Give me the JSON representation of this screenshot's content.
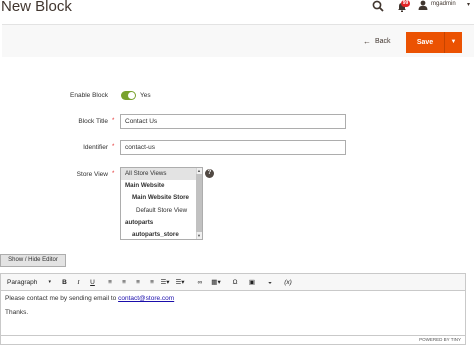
{
  "header": {
    "title": "New Block",
    "notifications_count": "99",
    "username": "mgadmin"
  },
  "actions": {
    "back_label": "Back",
    "save_label": "Save"
  },
  "form": {
    "enable_block": {
      "label": "Enable Block",
      "value_text": "Yes",
      "enabled": true
    },
    "block_title": {
      "label": "Block Title",
      "value": "Contact Us",
      "required": true
    },
    "identifier": {
      "label": "Identifier",
      "value": "contact-us",
      "required": true
    },
    "store_view": {
      "label": "Store View",
      "required": true,
      "options": [
        {
          "label": "All Store Views",
          "selected": true
        },
        {
          "label": "Main Website",
          "bold": true
        },
        {
          "label": "Main Website Store",
          "bold": true
        },
        {
          "label": "Default Store View"
        },
        {
          "label": "autoparts",
          "bold": true
        },
        {
          "label": "autoparts_store",
          "bold": true
        }
      ]
    }
  },
  "editor": {
    "show_hide_label": "Show / Hide Editor",
    "format_select": "Paragraph",
    "content_prefix": "Please contact me by sending email to ",
    "content_link": "contact@store.com",
    "content_line2": "Thanks.",
    "powered_by": "POWERED BY TINY"
  },
  "colors": {
    "accent": "#eb5202",
    "toggle_on": "#79a22e",
    "badge": "#e22626"
  }
}
